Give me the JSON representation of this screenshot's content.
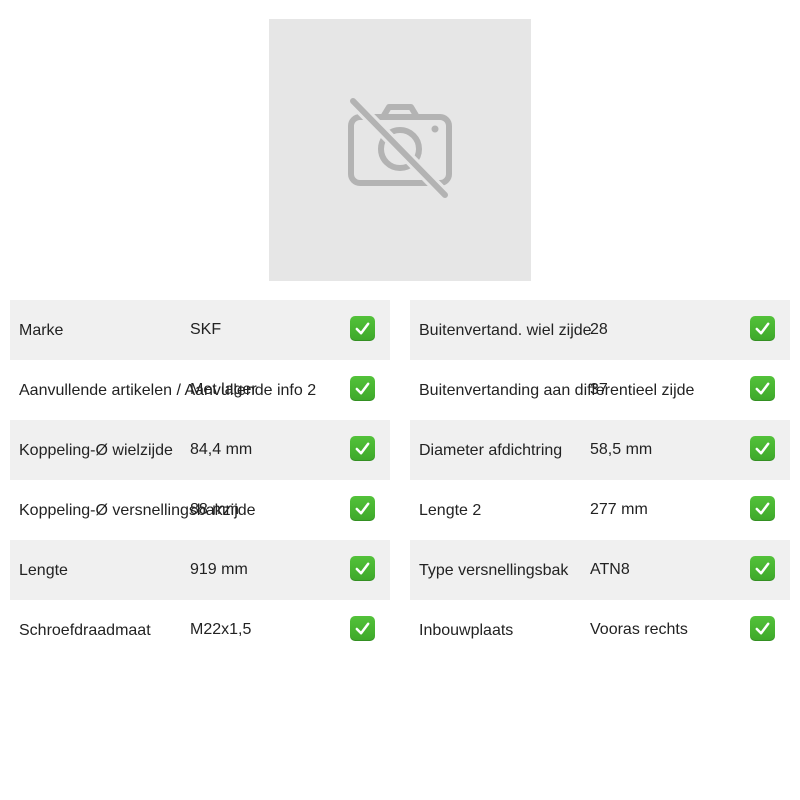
{
  "image": {
    "icon": "no-photo-icon"
  },
  "colors": {
    "check": "#45b030",
    "row_shade": "#f0f0f0",
    "placeholder_bg": "#e6e6e6"
  },
  "specs_left": [
    {
      "label": "Marke",
      "value": "SKF"
    },
    {
      "label": "Aanvullende artikelen / Aanvullende info 2",
      "value": "Met lager"
    },
    {
      "label": "Koppeling-Ø wielzijde",
      "value": "84,4 mm"
    },
    {
      "label": "Koppeling-Ø versnellingsbakzijde",
      "value": "88 mm"
    },
    {
      "label": "Lengte",
      "value": "919 mm"
    },
    {
      "label": "Schroefdraadmaat",
      "value": "M22x1,5"
    }
  ],
  "specs_right": [
    {
      "label": "Buitenvertand. wiel zijde",
      "value": "28"
    },
    {
      "label": "Buitenvertanding aan differentieel zijde",
      "value": "37"
    },
    {
      "label": "Diameter afdichtring",
      "value": "58,5 mm"
    },
    {
      "label": "Lengte 2",
      "value": "277 mm"
    },
    {
      "label": "Type versnellingsbak",
      "value": "ATN8"
    },
    {
      "label": "Inbouwplaats",
      "value": "Vooras rechts"
    }
  ]
}
